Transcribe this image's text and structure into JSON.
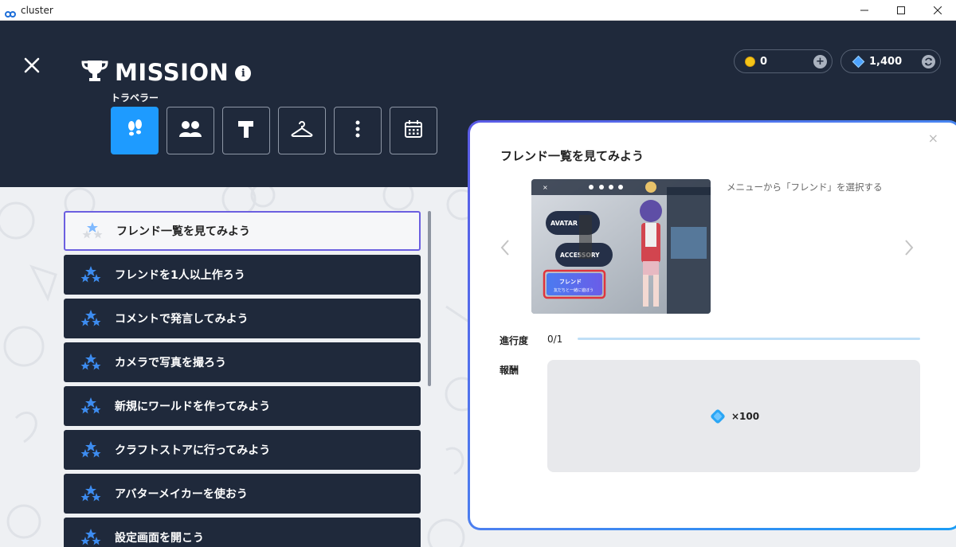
{
  "window": {
    "app_title": "cluster",
    "controls": [
      "minimize",
      "maximize",
      "close"
    ]
  },
  "header": {
    "title": "MISSION",
    "info_symbol": "i",
    "coins": "0",
    "gems": "1,400",
    "category_label": "トラベラー",
    "categories": [
      {
        "icon": "footprints-icon",
        "active": true
      },
      {
        "icon": "friends-icon",
        "active": false
      },
      {
        "icon": "hammer-icon",
        "active": false
      },
      {
        "icon": "hanger-icon",
        "active": false
      },
      {
        "icon": "more-vertical-icon",
        "active": false
      },
      {
        "icon": "calendar-icon",
        "active": false
      }
    ]
  },
  "missions": [
    {
      "label": "フレンド一覧を見てみよう",
      "selected": true
    },
    {
      "label": "フレンドを1人以上作ろう",
      "selected": false
    },
    {
      "label": "コメントで発言してみよう",
      "selected": false
    },
    {
      "label": "カメラで写真を撮ろう",
      "selected": false
    },
    {
      "label": "新規にワールドを作ってみよう",
      "selected": false
    },
    {
      "label": "クラフトストアに行ってみよう",
      "selected": false
    },
    {
      "label": "アバターメイカーを使おう",
      "selected": false
    },
    {
      "label": "設定画面を開こう",
      "selected": false
    }
  ],
  "detail": {
    "title": "フレンド一覧を見てみよう",
    "description": "メニューから「フレンド」を選択する",
    "preview": {
      "avatar_label": "AVATAR",
      "accessory_label": "ACCESSORY",
      "friend_button": "フレンド",
      "friend_sub": "友だちと一緒に遊ぼう"
    },
    "progress_label": "進行度",
    "progress_value": "0/1",
    "progress_ratio": 0,
    "reward_label": "報酬",
    "reward_amount": "×100"
  },
  "colors": {
    "header_bg": "#1f293b",
    "accent_blue": "#1e9bff",
    "selected_border": "#6b5fe0",
    "coin": "#f5c518",
    "gem": "#4da3ff"
  }
}
